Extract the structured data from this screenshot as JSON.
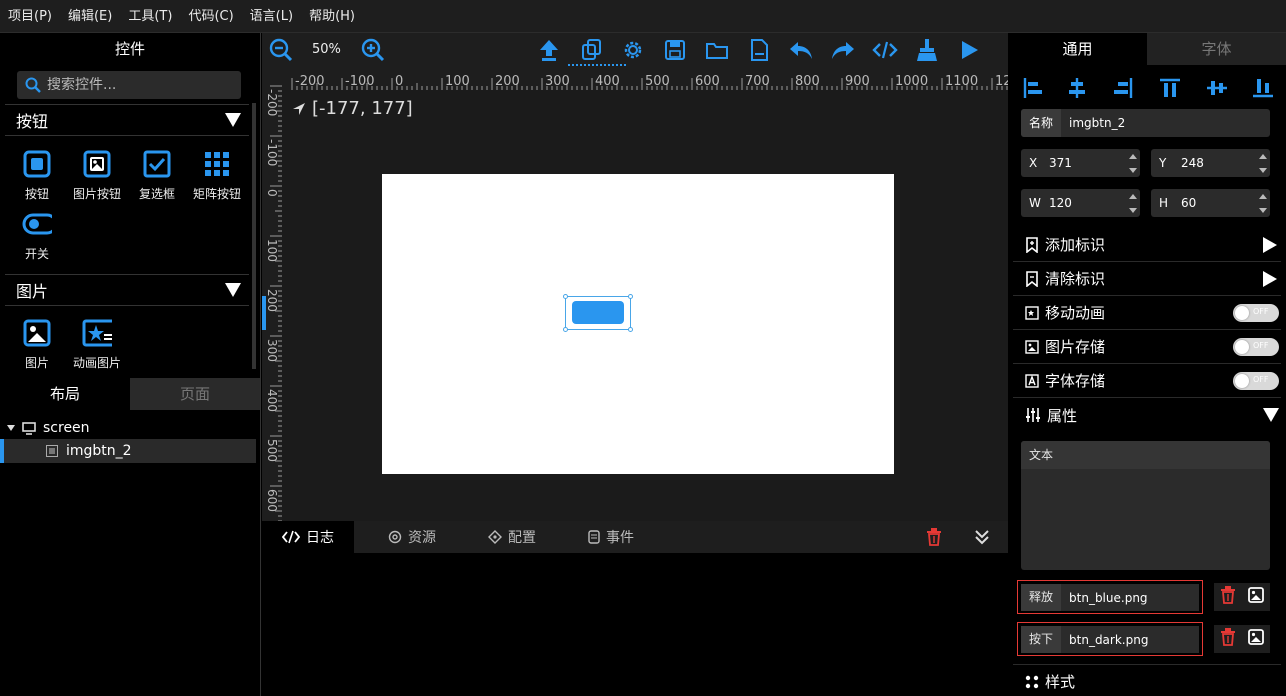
{
  "menu": [
    "项目(P)",
    "编辑(E)",
    "工具(T)",
    "代码(C)",
    "语言(L)",
    "帮助(H)"
  ],
  "left": {
    "title": "控件",
    "search_placeholder": "搜索控件...",
    "categories": [
      {
        "label": "按钮",
        "items": [
          "按钮",
          "图片按钮",
          "复选框",
          "矩阵按钮",
          "开关"
        ]
      },
      {
        "label": "图片",
        "items": [
          "图片",
          "动画图片"
        ]
      }
    ],
    "tabs": [
      "布局",
      "页面"
    ],
    "tree": {
      "root": "screen",
      "child": "imgbtn_2"
    }
  },
  "toolbar": {
    "zoom": "50%"
  },
  "ruler": {
    "x_ticks": [
      "-200",
      "-100",
      "0",
      "100",
      "200",
      "300",
      "400",
      "500",
      "600",
      "700",
      "800",
      "900",
      "1000",
      "1100",
      "120"
    ],
    "y_ticks": [
      "-200",
      "-100",
      "0",
      "100",
      "200",
      "300",
      "400",
      "500",
      "600"
    ]
  },
  "canvas": {
    "coord": "[-177, 177]"
  },
  "bottom_tabs": [
    "日志",
    "资源",
    "配置",
    "事件"
  ],
  "right": {
    "tabs": [
      "通用",
      "字体"
    ],
    "name_label": "名称",
    "name_value": "imgbtn_2",
    "x_label": "X",
    "x_value": "371",
    "y_label": "Y",
    "y_value": "248",
    "w_label": "W",
    "w_value": "120",
    "h_label": "H",
    "h_value": "60",
    "sections": {
      "add_mark": "添加标识",
      "clear_mark": "清除标识",
      "move_anim": "移动动画",
      "img_store": "图片存储",
      "font_store": "字体存储",
      "props": "属性",
      "style": "样式"
    },
    "toggle_off": "OFF",
    "text_label": "文本",
    "release_label": "释放",
    "release_value": "btn_blue.png",
    "pressed_label": "按下",
    "pressed_value": "btn_dark.png"
  },
  "colors": {
    "accent": "#2a96ef",
    "danger": "#e53935",
    "panel": "#1e1e1e"
  }
}
